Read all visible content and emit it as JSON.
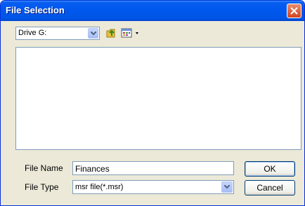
{
  "window": {
    "title": "File Selection"
  },
  "toolbar": {
    "drive_value": "Drive G:",
    "icons": [
      "folder-up-icon",
      "view-menu-icon"
    ]
  },
  "file_list": {
    "items": []
  },
  "form": {
    "file_name_label": "File Name",
    "file_name_value": "Finances",
    "file_type_label": "File Type",
    "file_type_value": "msr file(*.msr)"
  },
  "buttons": {
    "ok_label": "OK",
    "cancel_label": "Cancel"
  },
  "colors": {
    "title_bar": "#0058ee",
    "dialog_bg": "#ece9d8",
    "close_button": "#d2441f"
  }
}
